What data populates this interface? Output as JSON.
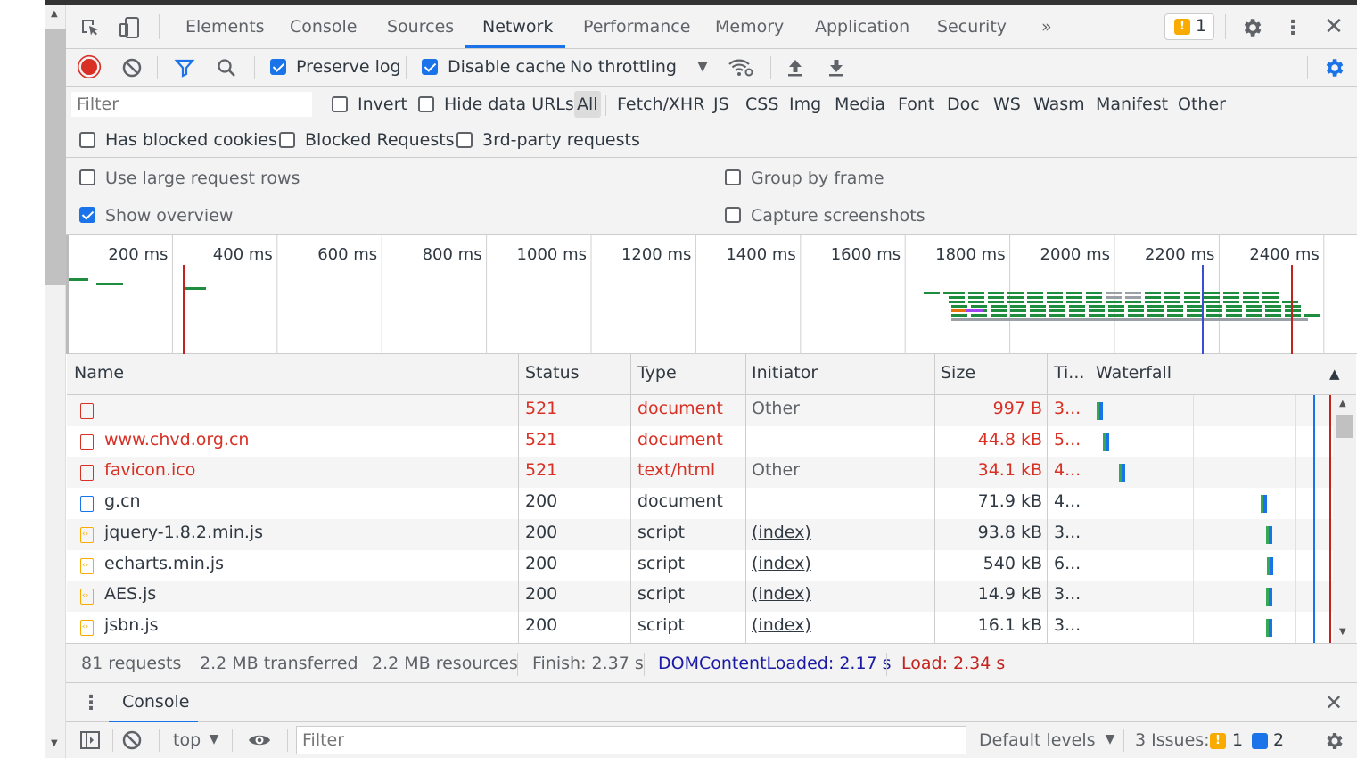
{
  "toolbar_tabs": [
    {
      "label": "Elements"
    },
    {
      "label": "Console"
    },
    {
      "label": "Sources"
    },
    {
      "label": "Network",
      "active": true
    },
    {
      "label": "Performance"
    },
    {
      "label": "Memory"
    },
    {
      "label": "Application"
    },
    {
      "label": "Security"
    }
  ],
  "issues_badge": {
    "count": "1"
  },
  "network_toolbar": {
    "preserve_log": {
      "label": "Preserve log",
      "checked": true
    },
    "disable_cache": {
      "label": "Disable cache",
      "checked": true
    },
    "throttling": "No throttling"
  },
  "filter_bar": {
    "placeholder": "Filter",
    "invert": "Invert",
    "hide_data_urls": "Hide data URLs",
    "types": [
      "All",
      "Fetch/XHR",
      "JS",
      "CSS",
      "Img",
      "Media",
      "Font",
      "Doc",
      "WS",
      "Wasm",
      "Manifest",
      "Other"
    ],
    "active_type": "All",
    "has_blocked_cookies": "Has blocked cookies",
    "blocked_requests": "Blocked Requests",
    "third_party": "3rd-party requests"
  },
  "settings": {
    "large_rows": {
      "label": "Use large request rows",
      "checked": false
    },
    "show_overview": {
      "label": "Show overview",
      "checked": true
    },
    "group_by_frame": {
      "label": "Group by frame",
      "checked": false
    },
    "capture_screenshots": {
      "label": "Capture screenshots",
      "checked": false
    }
  },
  "chart_data": {
    "type": "timeline",
    "x_ticks": [
      "200 ms",
      "400 ms",
      "600 ms",
      "800 ms",
      "1000 ms",
      "1200 ms",
      "1400 ms",
      "1600 ms",
      "1800 ms",
      "2000 ms",
      "2200 ms",
      "2400 ms"
    ],
    "xlim": [
      0,
      2400
    ],
    "markers": [
      {
        "name": "DOMContentLoaded",
        "ms": 2170,
        "color": "#3b4dd0"
      },
      {
        "name": "Load",
        "ms": 2340,
        "color": "#c5221f"
      },
      {
        "name": "Load (first)",
        "ms": 260,
        "color": "#c5221f"
      }
    ]
  },
  "table": {
    "columns": [
      "Name",
      "Status",
      "Type",
      "Initiator",
      "Size",
      "Ti...",
      "Waterfall"
    ],
    "rows": [
      {
        "name": "",
        "status": "521",
        "type": "document",
        "initiator": "Other",
        "size": "997 B",
        "time": "3...",
        "error": true,
        "icon": "doc"
      },
      {
        "name": "www.chvd.org.cn",
        "status": "521",
        "type": "document",
        "initiator": "",
        "size": "44.8 kB",
        "time": "5...",
        "error": true,
        "icon": "doc"
      },
      {
        "name": "favicon.ico",
        "status": "521",
        "type": "text/html",
        "initiator": "Other",
        "size": "34.1 kB",
        "time": "4...",
        "error": true,
        "icon": "doc"
      },
      {
        "name": "g.cn",
        "status": "200",
        "type": "document",
        "initiator": "",
        "size": "71.9 kB",
        "time": "4...",
        "error": false,
        "icon": "doc"
      },
      {
        "name": "jquery-1.8.2.min.js",
        "status": "200",
        "type": "script",
        "initiator": "(index)",
        "size": "93.8 kB",
        "time": "3...",
        "error": false,
        "icon": "script"
      },
      {
        "name": "echarts.min.js",
        "status": "200",
        "type": "script",
        "initiator": "(index)",
        "size": "540 kB",
        "time": "6...",
        "error": false,
        "icon": "script"
      },
      {
        "name": "AES.js",
        "status": "200",
        "type": "script",
        "initiator": "(index)",
        "size": "14.9 kB",
        "time": "3...",
        "error": false,
        "icon": "script"
      },
      {
        "name": "jsbn.js",
        "status": "200",
        "type": "script",
        "initiator": "(index)",
        "size": "16.1 kB",
        "time": "3...",
        "error": false,
        "icon": "script"
      }
    ]
  },
  "footer": {
    "requests": "81 requests",
    "transferred": "2.2 MB transferred",
    "resources": "2.2 MB resources",
    "finish": "Finish: 2.37 s",
    "dcl": "DOMContentLoaded: 2.17 s",
    "load": "Load: 2.34 s"
  },
  "drawer": {
    "tab": "Console",
    "context": "top",
    "filter_placeholder": "Filter",
    "levels": "Default levels",
    "issues_label": "3 Issues:",
    "issues_warn": "1",
    "issues_info": "2"
  },
  "colors": {
    "accent": "#1a73e8",
    "error": "#d93025",
    "dcl": "#1a1aa6",
    "load": "#c5221f"
  }
}
